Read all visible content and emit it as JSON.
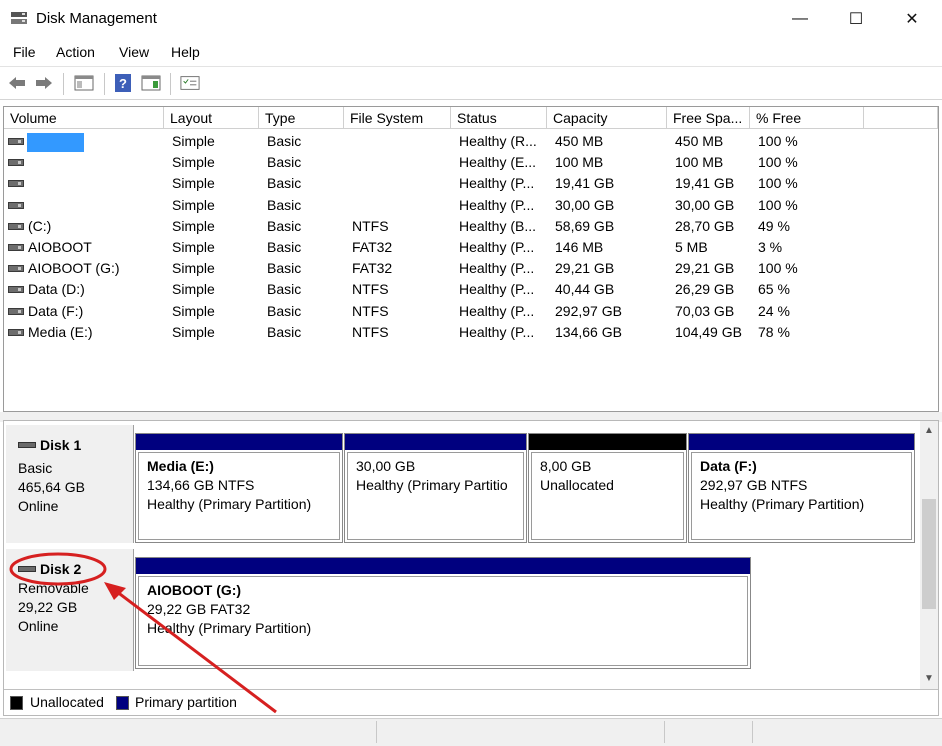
{
  "window": {
    "title": "Disk Management",
    "controls": {
      "minimize": "—",
      "maximize": "☐",
      "close": "✕"
    }
  },
  "menu": [
    "File",
    "Action",
    "View",
    "Help"
  ],
  "toolbar": {
    "icons": [
      "back-icon",
      "forward-icon",
      "properties-icon",
      "help-icon",
      "console-icon",
      "checklist-icon"
    ]
  },
  "volumes": {
    "headers": [
      "Volume",
      "Layout",
      "Type",
      "File System",
      "Status",
      "Capacity",
      "Free Spa...",
      "% Free"
    ],
    "rows": [
      {
        "volume": "",
        "layout": "Simple",
        "type": "Basic",
        "fs": "",
        "status": "Healthy (R...",
        "capacity": "450 MB",
        "free": "450 MB",
        "pct": "100 %",
        "highlight": true
      },
      {
        "volume": "",
        "layout": "Simple",
        "type": "Basic",
        "fs": "",
        "status": "Healthy (E...",
        "capacity": "100 MB",
        "free": "100 MB",
        "pct": "100 %"
      },
      {
        "volume": "",
        "layout": "Simple",
        "type": "Basic",
        "fs": "",
        "status": "Healthy (P...",
        "capacity": "19,41 GB",
        "free": "19,41 GB",
        "pct": "100 %"
      },
      {
        "volume": "",
        "layout": "Simple",
        "type": "Basic",
        "fs": "",
        "status": "Healthy (P...",
        "capacity": "30,00 GB",
        "free": "30,00 GB",
        "pct": "100 %"
      },
      {
        "volume": " (C:)",
        "layout": "Simple",
        "type": "Basic",
        "fs": "NTFS",
        "status": "Healthy (B...",
        "capacity": "58,69 GB",
        "free": "28,70 GB",
        "pct": "49 %"
      },
      {
        "volume": "AIOBOOT",
        "layout": "Simple",
        "type": "Basic",
        "fs": "FAT32",
        "status": "Healthy (P...",
        "capacity": "146 MB",
        "free": "5 MB",
        "pct": "3 %"
      },
      {
        "volume": "AIOBOOT (G:)",
        "layout": "Simple",
        "type": "Basic",
        "fs": "FAT32",
        "status": "Healthy (P...",
        "capacity": "29,21 GB",
        "free": "29,21 GB",
        "pct": "100 %"
      },
      {
        "volume": "Data (D:)",
        "layout": "Simple",
        "type": "Basic",
        "fs": "NTFS",
        "status": "Healthy (P...",
        "capacity": "40,44 GB",
        "free": "26,29 GB",
        "pct": "65 %"
      },
      {
        "volume": "Data (F:)",
        "layout": "Simple",
        "type": "Basic",
        "fs": "NTFS",
        "status": "Healthy (P...",
        "capacity": "292,97 GB",
        "free": "70,03 GB",
        "pct": "24 %"
      },
      {
        "volume": "Media (E:)",
        "layout": "Simple",
        "type": "Basic",
        "fs": "NTFS",
        "status": "Healthy (P...",
        "capacity": "134,66 GB",
        "free": "104,49 GB",
        "pct": "78 %"
      }
    ]
  },
  "disks": [
    {
      "name": "Disk 1",
      "kind": "Basic",
      "size": "465,64 GB",
      "state": "Online",
      "partitions": [
        {
          "name": "Media  (E:)",
          "line1": "134,66 GB NTFS",
          "line2": "Healthy (Primary Partition)",
          "bar": "#00007f"
        },
        {
          "name": "",
          "line1": "30,00 GB",
          "line2": "Healthy (Primary Partitio",
          "bar": "#00007f"
        },
        {
          "name": "",
          "line1": "8,00 GB",
          "line2": "Unallocated",
          "bar": "#000000"
        },
        {
          "name": "Data  (F:)",
          "line1": "292,97 GB NTFS",
          "line2": "Healthy (Primary Partition)",
          "bar": "#00007f"
        }
      ]
    },
    {
      "name": "Disk 2",
      "kind": "Removable",
      "size": "29,22 GB",
      "state": "Online",
      "partitions": [
        {
          "name": "AIOBOOT  (G:)",
          "line1": "29,22 GB FAT32",
          "line2": "Healthy (Primary Partition)",
          "bar": "#00007f"
        }
      ]
    }
  ],
  "legend": [
    {
      "label": "Unallocated",
      "color": "#000000"
    },
    {
      "label": "Primary partition",
      "color": "#00007f"
    }
  ],
  "colors": {
    "primary": "#00007f",
    "unallocated": "#000000",
    "highlight": "#3399ff",
    "annotation": "#d62020"
  }
}
